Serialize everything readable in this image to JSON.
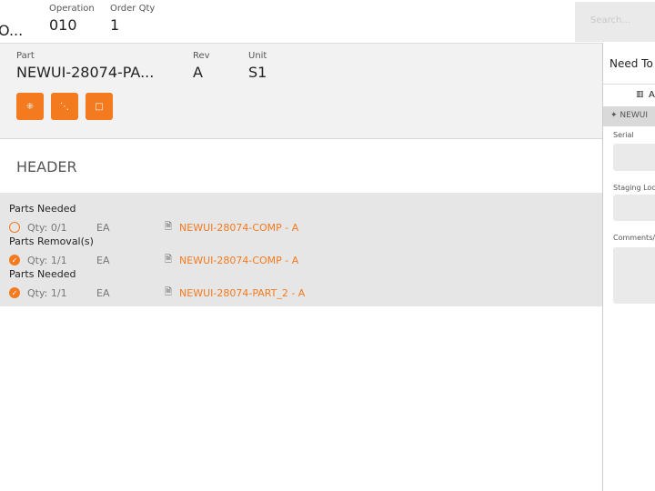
{
  "top": {
    "first_value": "O...",
    "operation_label": "Operation",
    "operation_value": "010",
    "order_qty_label": "Order Qty",
    "order_qty_value": "1",
    "search_placeholder": "Search..."
  },
  "part": {
    "part_label": "Part",
    "part_value": "NEWUI-28074-PA...",
    "rev_label": "Rev",
    "rev_value": "A",
    "unit_label": "Unit",
    "unit_value": "S1"
  },
  "section_title": "HEADER",
  "groups": [
    {
      "title": "Parts Needed",
      "qty": "Qty: 0/1",
      "uom": "EA",
      "part": "NEWUI-28074-COMP - A",
      "done": false
    },
    {
      "title": "Parts Removal(s)",
      "qty": "Qty: 1/1",
      "uom": "EA",
      "part": "NEWUI-28074-COMP - A",
      "done": true
    },
    {
      "title": "Parts Needed",
      "qty": "Qty: 1/1",
      "uom": "EA",
      "part": "NEWUI-28074-PART_2 - A",
      "done": true
    }
  ],
  "right": {
    "title": "Need To",
    "tab": "A",
    "part": "NEWUI",
    "serial_label": "Serial",
    "staging_label": "Staging Locat",
    "comments_label": "Comments/o"
  },
  "colors": {
    "accent": "#f47a20"
  }
}
